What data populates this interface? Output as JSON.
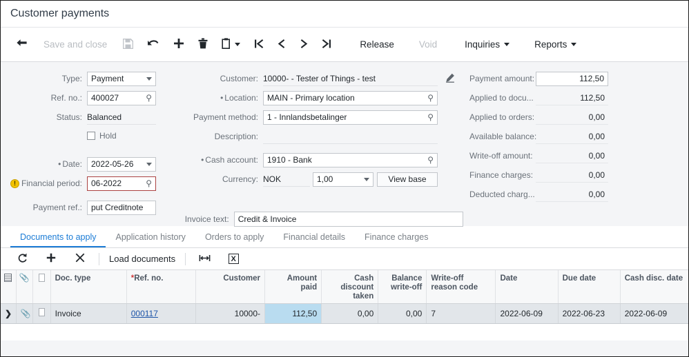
{
  "window": {
    "title": "Customer payments"
  },
  "toolbar": {
    "back_icon": "back-arrow-icon",
    "save_and_close": "Save and close",
    "save_icon": "save-icon",
    "undo_icon": "undo-icon",
    "add_icon": "plus-icon",
    "delete_icon": "trash-icon",
    "clipboard_icon": "clipboard-icon",
    "first_icon": "first-record-icon",
    "prev_icon": "previous-record-icon",
    "next_icon": "next-record-icon",
    "last_icon": "last-record-icon",
    "release": "Release",
    "void": "Void",
    "inquiries": "Inquiries",
    "reports": "Reports"
  },
  "form": {
    "left": {
      "type_label": "Type:",
      "type_value": "Payment",
      "ref_no_label": "Ref. no.:",
      "ref_no_value": "400027",
      "status_label": "Status:",
      "status_value": "Balanced",
      "hold_label": "Hold",
      "hold_checked": false,
      "date_label": "Date:",
      "date_value": "2022-05-26",
      "financial_period_label": "Financial period:",
      "financial_period_value": "06-2022",
      "payment_ref_label": "Payment ref.:",
      "payment_ref_value": "put Creditnote"
    },
    "middle": {
      "customer_label": "Customer:",
      "customer_value": "10000- - Tester of Things - test",
      "location_label": "Location:",
      "location_value": "MAIN - Primary location",
      "payment_method_label": "Payment method:",
      "payment_method_value": "1 - Innlandsbetalinger",
      "description_label": "Description:",
      "description_value": "",
      "cash_account_label": "Cash account:",
      "cash_account_value": "1910 - Bank",
      "currency_label": "Currency:",
      "currency_value": "NOK",
      "currency_rate": "1,00",
      "view_base_button": "View base",
      "invoice_text_label": "Invoice text:",
      "invoice_text_value": "Credit & Invoice"
    },
    "right": [
      {
        "label": "Payment amount:",
        "value": "112,50",
        "input": true
      },
      {
        "label": "Applied to docu...",
        "value": "112,50",
        "input": false
      },
      {
        "label": "Applied to orders:",
        "value": "0,00",
        "input": false
      },
      {
        "label": "Available balance:",
        "value": "0,00",
        "input": false
      },
      {
        "label": "Write-off amount:",
        "value": "0,00",
        "input": false
      },
      {
        "label": "Finance charges:",
        "value": "0,00",
        "input": false
      },
      {
        "label": "Deducted charg...",
        "value": "0,00",
        "input": false
      }
    ]
  },
  "tabs": [
    {
      "label": "Documents to apply",
      "active": true
    },
    {
      "label": "Application history",
      "active": false
    },
    {
      "label": "Orders to apply",
      "active": false
    },
    {
      "label": "Financial details",
      "active": false
    },
    {
      "label": "Finance charges",
      "active": false
    }
  ],
  "grid_toolbar": {
    "refresh_icon": "refresh-icon",
    "add_icon": "plus-icon",
    "delete_icon": "close-x-icon",
    "load_documents": "Load documents",
    "fit_columns_icon": "fit-columns-icon",
    "export_excel_icon": "export-excel-icon",
    "export_excel_glyph": "X"
  },
  "table": {
    "columns": [
      {
        "key": "colsel",
        "label": "",
        "align": "ico"
      },
      {
        "key": "attach",
        "label": "",
        "align": "ico"
      },
      {
        "key": "note",
        "label": "",
        "align": "ico"
      },
      {
        "key": "doc_type",
        "label": "Doc. type",
        "align": "l"
      },
      {
        "key": "ref_no",
        "label": "Ref. no.",
        "align": "l",
        "required": true
      },
      {
        "key": "customer",
        "label": "Customer",
        "align": "r"
      },
      {
        "key": "amount_paid",
        "label": "Amount paid",
        "align": "r"
      },
      {
        "key": "cash_discount_taken",
        "label": "Cash discount taken",
        "align": "r"
      },
      {
        "key": "balance_write_off",
        "label": "Balance write-off",
        "align": "r"
      },
      {
        "key": "write_off_reason_code",
        "label": "Write-off reason code",
        "align": "l"
      },
      {
        "key": "date",
        "label": "Date",
        "align": "l"
      },
      {
        "key": "due_date",
        "label": "Due date",
        "align": "l"
      },
      {
        "key": "cash_disc_date",
        "label": "Cash disc. date",
        "align": "l"
      }
    ],
    "rows": [
      {
        "selected_marker": "❯",
        "doc_type": "Invoice",
        "ref_no": "000117",
        "customer": "10000-",
        "amount_paid": "112,50",
        "cash_discount_taken": "0,00",
        "balance_write_off": "0,00",
        "write_off_reason_code": "7",
        "date": "2022-06-09",
        "due_date": "2022-06-23",
        "cash_disc_date": "2022-06-09"
      }
    ]
  },
  "colors": {
    "accent": "#1c7cd6",
    "link": "#1c54a8",
    "selected_cell": "#b9dcf0",
    "error_border": "#ab4141",
    "warning": "#f2c200"
  }
}
